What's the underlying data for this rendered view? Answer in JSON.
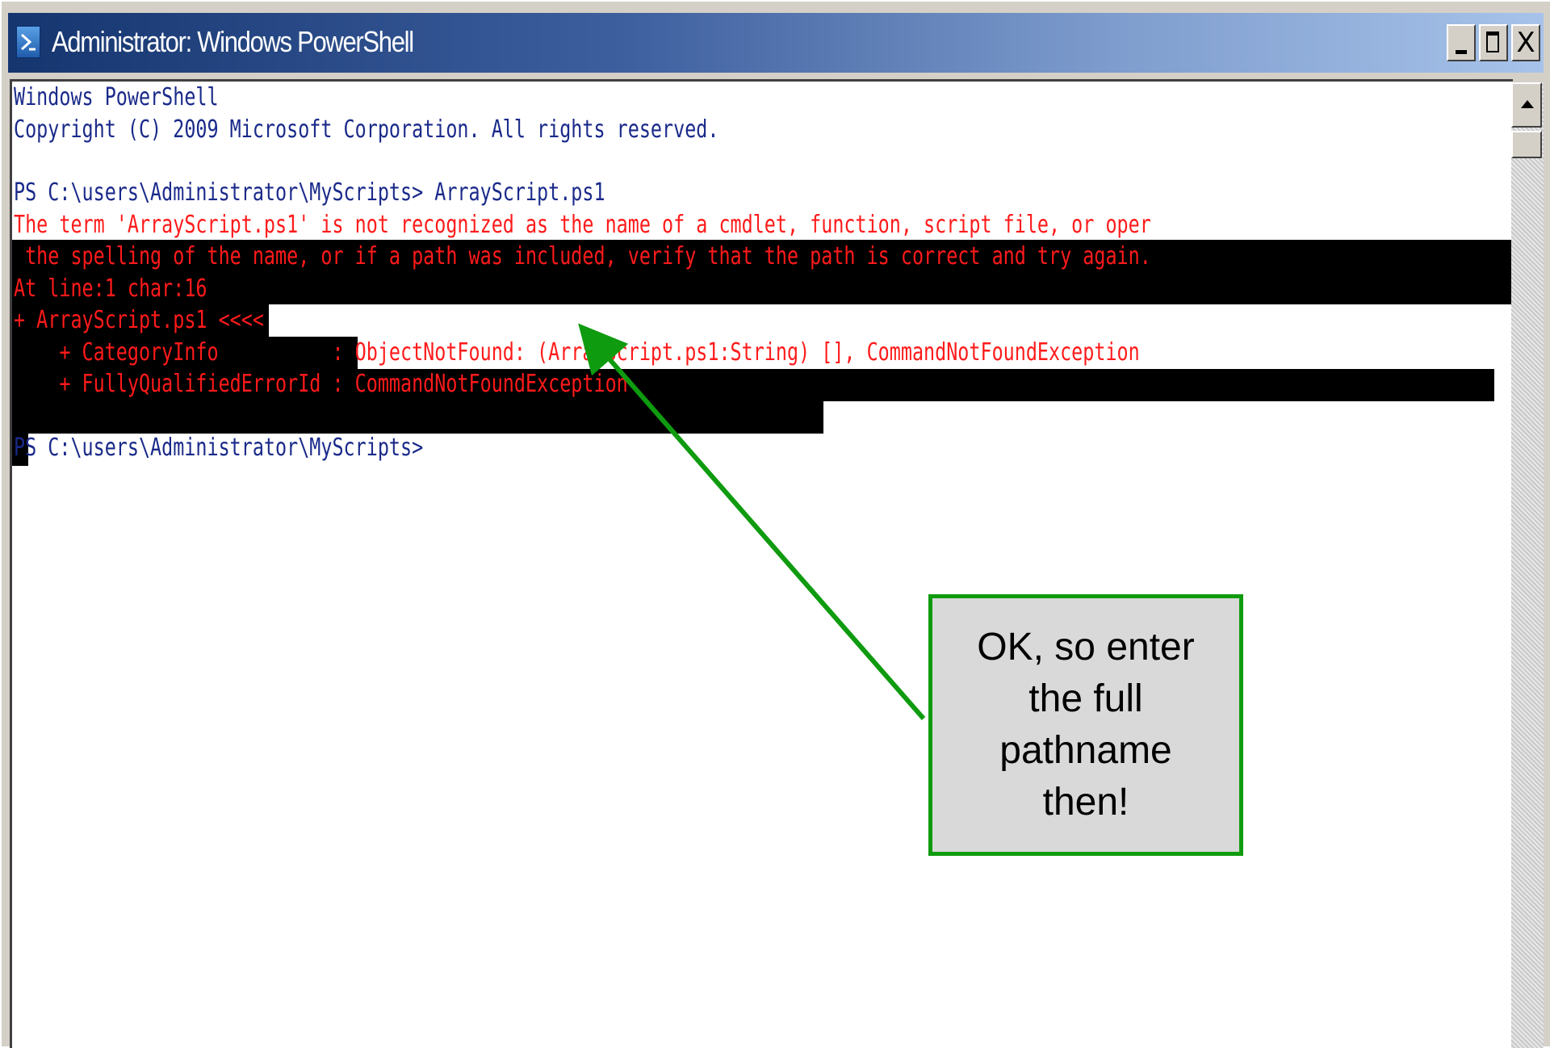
{
  "window": {
    "title": "Administrator: Windows PowerShell",
    "minimize_label": "_",
    "maximize_label": "□",
    "close_label": "X"
  },
  "console": {
    "lines": [
      "Windows PowerShell",
      "Copyright (C) 2009 Microsoft Corporation. All rights reserved.",
      "",
      "PS C:\\users\\Administrator\\MyScripts> ArrayScript.ps1",
      "The term 'ArrayScript.ps1' is not recognized as the name of a cmdlet, function, script file, or oper",
      " the spelling of the name, or if a path was included, verify that the path is correct and try again.",
      "At line:1 char:16",
      "+ ArrayScript.ps1 <<<< ",
      "    + CategoryInfo          : ObjectNotFound: (ArrayScript.ps1:String) [], CommandNotFoundException",
      "    + FullyQualifiedErrorId : CommandNotFoundException",
      " ",
      "PS C:\\users\\Administrator\\MyScripts>"
    ]
  },
  "callout": {
    "text": "OK, so enter the full pathname then!"
  },
  "colors": {
    "console_text": "#1a2a8a",
    "error_text": "#ff1a1a",
    "error_background": "#000000",
    "callout_border": "#0f9b0f",
    "callout_fill": "#d9d9d9",
    "arrow": "#0f9b0f"
  },
  "icons": {
    "app_icon": "powershell-icon",
    "scroll_up": "arrow-up-icon"
  }
}
